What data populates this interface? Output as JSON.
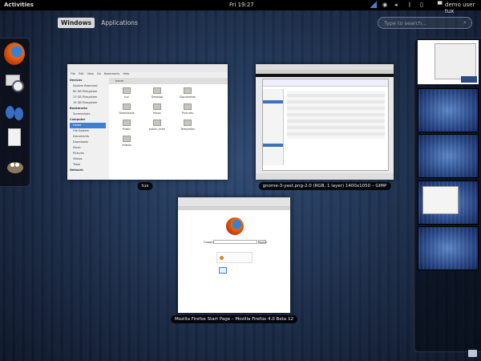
{
  "topbar": {
    "activities": "Activities",
    "clock": "Fri 19:27",
    "user": "demo user tux"
  },
  "overview": {
    "tabs": [
      {
        "label": "Windows",
        "active": true
      },
      {
        "label": "Applications",
        "active": false
      }
    ],
    "search_placeholder": "Type to search..."
  },
  "dash": {
    "items": [
      "firefox",
      "mail-clock",
      "empathy",
      "document",
      "gimp"
    ]
  },
  "windows": [
    {
      "caption": "tux",
      "menu": [
        "File",
        "Edit",
        "View",
        "Go",
        "Bookmarks",
        "Help"
      ],
      "location": "home",
      "sidebar": {
        "Devices": [
          "System Reserved",
          "80 GB Filesystem",
          "23 GB Filesystem",
          "19 GB Filesystem"
        ],
        "Bookmarks": [
          "Screenshots"
        ],
        "Computer": [
          "Home",
          "File System",
          "Documents",
          "Downloads",
          "Music",
          "Pictures",
          "Videos",
          "Trash"
        ],
        "Network": []
      },
      "folders": [
        "tux",
        "Desktop",
        "Documents",
        "Downloads",
        "Music",
        "Pictures",
        "Public",
        "public_html",
        "Templates",
        "Videos"
      ]
    },
    {
      "caption": "gnome-3-yast.png-2.0 (RGB, 1 layer) 1400x1050 – GIMP"
    },
    {
      "caption": "Mozilla Firefox Start Page – Mozilla Firefox 4.0 Beta 12",
      "search_label": "Google",
      "search_button": "Search"
    }
  ],
  "workspaces": [
    {
      "active": true
    },
    {
      "active": false
    },
    {
      "active": false
    },
    {
      "active": false
    },
    {
      "active": false
    }
  ]
}
